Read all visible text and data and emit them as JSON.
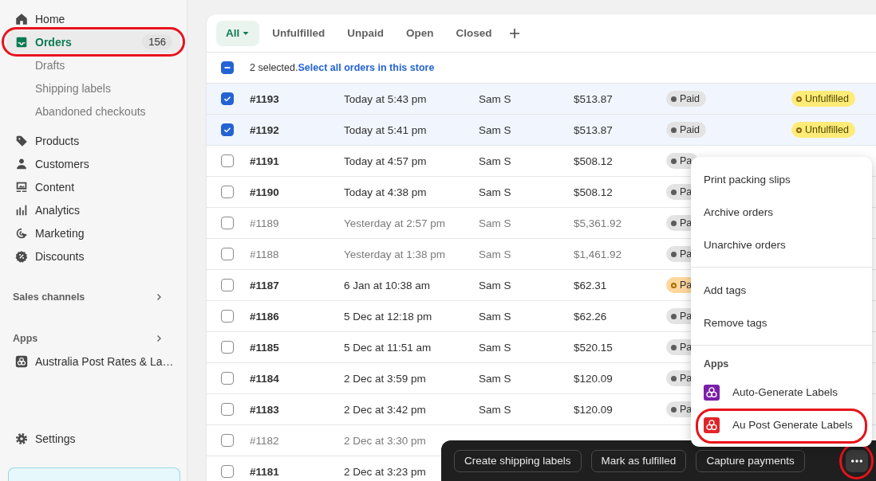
{
  "sidebar": {
    "items": [
      {
        "label": "Home",
        "kind": "main",
        "selected": false
      },
      {
        "label": "Orders",
        "kind": "main",
        "selected": true,
        "badge": "156",
        "highlighted": true
      },
      {
        "label": "Drafts",
        "kind": "sub",
        "selected": false
      },
      {
        "label": "Shipping labels",
        "kind": "sub",
        "selected": false
      },
      {
        "label": "Abandoned checkouts",
        "kind": "sub",
        "selected": false
      },
      {
        "label": "Products",
        "kind": "main",
        "selected": false
      },
      {
        "label": "Customers",
        "kind": "main",
        "selected": false
      },
      {
        "label": "Content",
        "kind": "main",
        "selected": false
      },
      {
        "label": "Analytics",
        "kind": "main",
        "selected": false
      },
      {
        "label": "Marketing",
        "kind": "main",
        "selected": false
      },
      {
        "label": "Discounts",
        "kind": "main",
        "selected": false
      }
    ],
    "sections": [
      {
        "title": "Sales channels"
      },
      {
        "title": "Apps",
        "items": [
          {
            "label": "Australia Post Rates & La…"
          }
        ]
      }
    ],
    "settings": {
      "label": "Settings"
    }
  },
  "tabs": [
    {
      "label": "All",
      "selected": true
    },
    {
      "label": "Unfulfilled",
      "selected": false
    },
    {
      "label": "Unpaid",
      "selected": false
    },
    {
      "label": "Open",
      "selected": false
    },
    {
      "label": "Closed",
      "selected": false
    }
  ],
  "selection": {
    "checked": true,
    "indeterminate": true,
    "summary": "2 selected.",
    "link": "Select all orders in this store"
  },
  "orders": [
    {
      "order": "#1193",
      "date": "Today at 5:43 pm",
      "customer": "Sam S",
      "total": "$513.87",
      "payment": {
        "text": "Paid",
        "kind": "paid"
      },
      "fulfillment": {
        "text": "Unfulfilled",
        "kind": "unfulfilled"
      },
      "selected": true,
      "archived": false
    },
    {
      "order": "#1192",
      "date": "Today at 5:41 pm",
      "customer": "Sam S",
      "total": "$513.87",
      "payment": {
        "text": "Paid",
        "kind": "paid"
      },
      "fulfillment": {
        "text": "Unfulfilled",
        "kind": "unfulfilled"
      },
      "selected": true,
      "archived": false
    },
    {
      "order": "#1191",
      "date": "Today at 4:57 pm",
      "customer": "Sam S",
      "total": "$508.12",
      "payment": {
        "text": "Pa",
        "kind": "paid"
      },
      "selected": false,
      "archived": false
    },
    {
      "order": "#1190",
      "date": "Today at 4:38 pm",
      "customer": "Sam S",
      "total": "$508.12",
      "payment": {
        "text": "Pa",
        "kind": "paid"
      },
      "selected": false,
      "archived": false
    },
    {
      "order": "#1189",
      "date": "Yesterday at 2:57 pm",
      "customer": "Sam S",
      "total": "$5,361.92",
      "payment": {
        "text": "Pa",
        "kind": "paid"
      },
      "selected": false,
      "archived": true
    },
    {
      "order": "#1188",
      "date": "Yesterday at 1:38 pm",
      "customer": "Sam S",
      "total": "$1,461.92",
      "payment": {
        "text": "Pa",
        "kind": "paid"
      },
      "selected": false,
      "archived": true
    },
    {
      "order": "#1187",
      "date": "6 Jan at 10:38 am",
      "customer": "Sam S",
      "total": "$62.31",
      "payment": {
        "text": "Pa",
        "kind": "pending"
      },
      "selected": false,
      "archived": false
    },
    {
      "order": "#1186",
      "date": "5 Dec at 12:18 pm",
      "customer": "Sam S",
      "total": "$62.26",
      "payment": {
        "text": "Pa",
        "kind": "paid"
      },
      "selected": false,
      "archived": false
    },
    {
      "order": "#1185",
      "date": "5 Dec at 11:51 am",
      "customer": "Sam S",
      "total": "$520.15",
      "payment": {
        "text": "Pa",
        "kind": "paid"
      },
      "selected": false,
      "archived": false
    },
    {
      "order": "#1184",
      "date": "2 Dec at 3:59 pm",
      "customer": "Sam S",
      "total": "$120.09",
      "payment": {
        "text": "Pa",
        "kind": "paid"
      },
      "selected": false,
      "archived": false
    },
    {
      "order": "#1183",
      "date": "2 Dec at 3:42 pm",
      "customer": "Sam S",
      "total": "$120.09",
      "payment": {
        "text": "Pa",
        "kind": "paid"
      },
      "selected": false,
      "archived": false
    },
    {
      "order": "#1182",
      "date": "2 Dec at 3:30 pm",
      "selected": false,
      "archived": true
    },
    {
      "order": "#1181",
      "date": "2 Dec at 3:23 pm",
      "selected": false,
      "archived": false
    }
  ],
  "menu": {
    "groups": [
      {
        "items": [
          {
            "label": "Print packing slips"
          },
          {
            "label": "Archive orders"
          },
          {
            "label": "Unarchive orders"
          }
        ]
      },
      {
        "items": [
          {
            "label": "Add tags"
          },
          {
            "label": "Remove tags"
          }
        ]
      },
      {
        "heading": "Apps",
        "items": [
          {
            "label": "Auto-Generate Labels",
            "color": "#7b1fa8",
            "highlighted": false
          },
          {
            "label": "Au Post Generate Labels",
            "color": "#e0252a",
            "highlighted": true
          }
        ]
      }
    ]
  },
  "action_bar": {
    "buttons": [
      {
        "label": "Create shipping labels"
      },
      {
        "label": "Mark as fulfilled"
      },
      {
        "label": "Capture payments"
      }
    ],
    "more_button": {
      "highlighted": true
    }
  }
}
